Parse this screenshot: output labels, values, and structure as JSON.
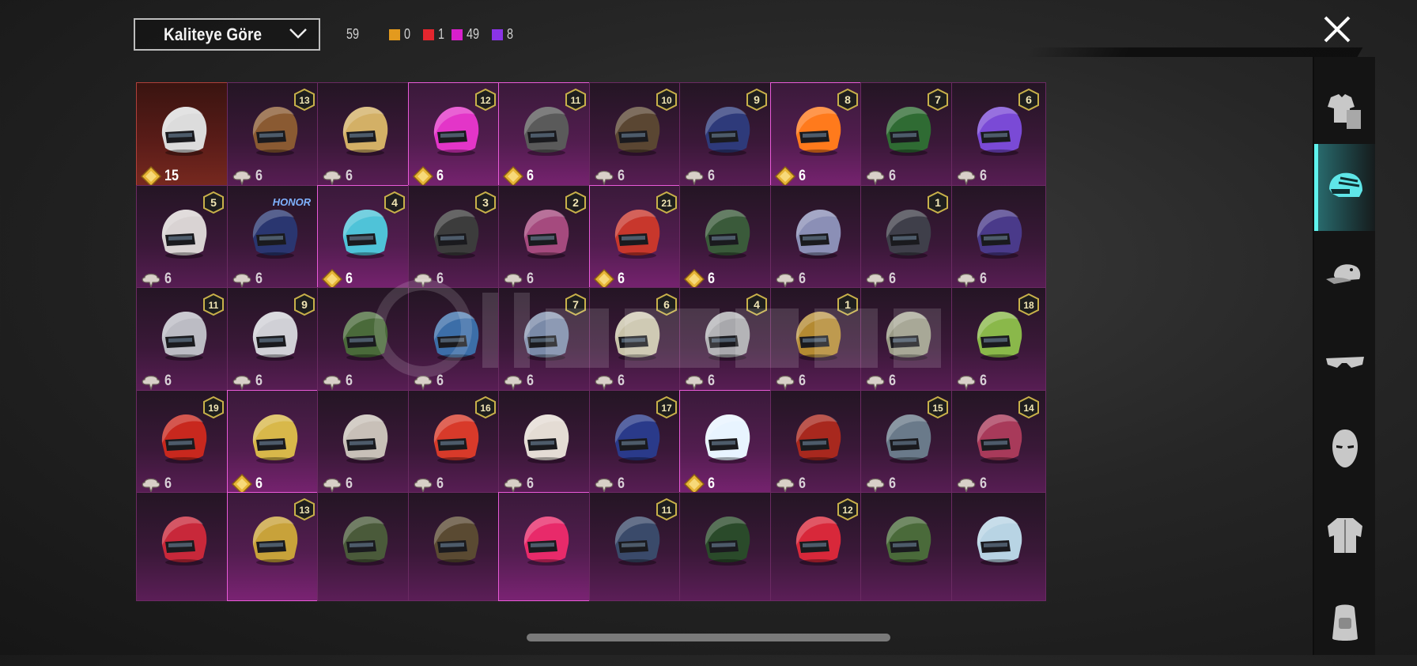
{
  "header": {
    "sort_label": "Kaliteye Göre",
    "total": "59",
    "counts": [
      {
        "color": "#e39a1e",
        "value": "0"
      },
      {
        "color": "#e3262e",
        "value": "1"
      },
      {
        "color": "#d81fcc",
        "value": "49"
      },
      {
        "color": "#8a34e6",
        "value": "8"
      }
    ]
  },
  "sidebar": {
    "items": [
      {
        "icon": "outfit-icon",
        "active": false
      },
      {
        "icon": "helmet-icon",
        "active": true
      },
      {
        "icon": "cap-icon",
        "active": false
      },
      {
        "icon": "glasses-icon",
        "active": false
      },
      {
        "icon": "mask-icon",
        "active": false
      },
      {
        "icon": "jacket-icon",
        "active": false
      },
      {
        "icon": "backpack-icon",
        "active": false
      }
    ]
  },
  "items": [
    {
      "c": "#dcdcdc",
      "v": "",
      "q": "15",
      "t": "gold",
      "s": "red"
    },
    {
      "c": "#8a5a32",
      "v": "13",
      "q": "6",
      "t": "grey",
      "s": ""
    },
    {
      "c": "#d3b066",
      "v": "",
      "q": "6",
      "t": "grey",
      "s": ""
    },
    {
      "c": "#e335c8",
      "v": "12",
      "q": "6",
      "t": "gold",
      "s": "hi"
    },
    {
      "c": "#5a5a5a",
      "v": "11",
      "q": "6",
      "t": "gold",
      "s": "hi"
    },
    {
      "c": "#5a4632",
      "v": "10",
      "q": "6",
      "t": "grey",
      "s": ""
    },
    {
      "c": "#2e3a7a",
      "v": "9",
      "q": "6",
      "t": "grey",
      "s": ""
    },
    {
      "c": "#ff7a1c",
      "v": "8",
      "q": "6",
      "t": "gold",
      "s": "hi"
    },
    {
      "c": "#2f6b33",
      "v": "7",
      "q": "6",
      "t": "grey",
      "s": ""
    },
    {
      "c": "#7a4ad6",
      "v": "6",
      "q": "6",
      "t": "grey",
      "s": ""
    },
    {
      "c": "#d9d3d3",
      "v": "5",
      "q": "6",
      "t": "grey",
      "s": ""
    },
    {
      "c": "#2a3670",
      "v": "HONOR",
      "q": "6",
      "t": "grey",
      "s": ""
    },
    {
      "c": "#4fc3d8",
      "v": "4",
      "q": "6",
      "t": "gold",
      "s": "hi"
    },
    {
      "c": "#3c3c3c",
      "v": "3",
      "q": "6",
      "t": "grey",
      "s": ""
    },
    {
      "c": "#a54a7e",
      "v": "2",
      "q": "6",
      "t": "grey",
      "s": ""
    },
    {
      "c": "#c8372c",
      "v": "21",
      "q": "6",
      "t": "gold",
      "s": "hi"
    },
    {
      "c": "#3a5a3a",
      "v": "",
      "q": "6",
      "t": "gold",
      "s": ""
    },
    {
      "c": "#8b8fb6",
      "v": "",
      "q": "6",
      "t": "grey",
      "s": ""
    },
    {
      "c": "#3f3f4a",
      "v": "1",
      "q": "6",
      "t": "grey",
      "s": ""
    },
    {
      "c": "#4a3a8a",
      "v": "",
      "q": "6",
      "t": "grey",
      "s": ""
    },
    {
      "c": "#bcbcc4",
      "v": "11",
      "q": "6",
      "t": "grey",
      "s": ""
    },
    {
      "c": "#d0d0d6",
      "v": "9",
      "q": "6",
      "t": "grey",
      "s": ""
    },
    {
      "c": "#4a6a3a",
      "v": "",
      "q": "6",
      "t": "grey",
      "s": ""
    },
    {
      "c": "#3c6ea8",
      "v": "",
      "q": "6",
      "t": "grey",
      "s": ""
    },
    {
      "c": "#7a8aa8",
      "v": "7",
      "q": "6",
      "t": "grey",
      "s": ""
    },
    {
      "c": "#c8c2a8",
      "v": "6",
      "q": "6",
      "t": "grey",
      "s": ""
    },
    {
      "c": "#a8a8ac",
      "v": "4",
      "q": "6",
      "t": "grey",
      "s": ""
    },
    {
      "c": "#b48a32",
      "v": "1",
      "q": "6",
      "t": "grey",
      "s": ""
    },
    {
      "c": "#9a9a86",
      "v": "",
      "q": "6",
      "t": "grey",
      "s": ""
    },
    {
      "c": "#8ab84a",
      "v": "18",
      "q": "6",
      "t": "grey",
      "s": ""
    },
    {
      "c": "#c8281e",
      "v": "19",
      "q": "6",
      "t": "grey",
      "s": ""
    },
    {
      "c": "#d8b84a",
      "v": "",
      "q": "6",
      "t": "gold",
      "s": "hi"
    },
    {
      "c": "#c8c0b8",
      "v": "",
      "q": "6",
      "t": "grey",
      "s": ""
    },
    {
      "c": "#d83a2a",
      "v": "16",
      "q": "6",
      "t": "grey",
      "s": ""
    },
    {
      "c": "#e4dcd4",
      "v": "",
      "q": "6",
      "t": "grey",
      "s": ""
    },
    {
      "c": "#2a3a8a",
      "v": "17",
      "q": "6",
      "t": "grey",
      "s": ""
    },
    {
      "c": "#e8f4ff",
      "v": "",
      "q": "6",
      "t": "gold",
      "s": "hi"
    },
    {
      "c": "#a8281e",
      "v": "",
      "q": "6",
      "t": "grey",
      "s": ""
    },
    {
      "c": "#6a7a8a",
      "v": "15",
      "q": "6",
      "t": "grey",
      "s": ""
    },
    {
      "c": "#a83a5a",
      "v": "14",
      "q": "6",
      "t": "grey",
      "s": ""
    },
    {
      "c": "#c8283a",
      "v": "",
      "q": "",
      "t": "grey",
      "s": ""
    },
    {
      "c": "#c8a23a",
      "v": "13",
      "q": "",
      "t": "grey",
      "s": "hi"
    },
    {
      "c": "#4a5a3a",
      "v": "",
      "q": "",
      "t": "grey",
      "s": ""
    },
    {
      "c": "#5a4a32",
      "v": "",
      "q": "",
      "t": "grey",
      "s": ""
    },
    {
      "c": "#e82a6a",
      "v": "",
      "q": "",
      "t": "grey",
      "s": "hi"
    },
    {
      "c": "#3a4a6a",
      "v": "11",
      "q": "",
      "t": "grey",
      "s": ""
    },
    {
      "c": "#2a4a2a",
      "v": "",
      "q": "",
      "t": "grey",
      "s": ""
    },
    {
      "c": "#d8283a",
      "v": "12",
      "q": "",
      "t": "grey",
      "s": ""
    },
    {
      "c": "#4a6a3a",
      "v": "",
      "q": "",
      "t": "grey",
      "s": ""
    },
    {
      "c": "#b8d4e4",
      "v": "",
      "q": "",
      "t": "grey",
      "s": ""
    }
  ]
}
